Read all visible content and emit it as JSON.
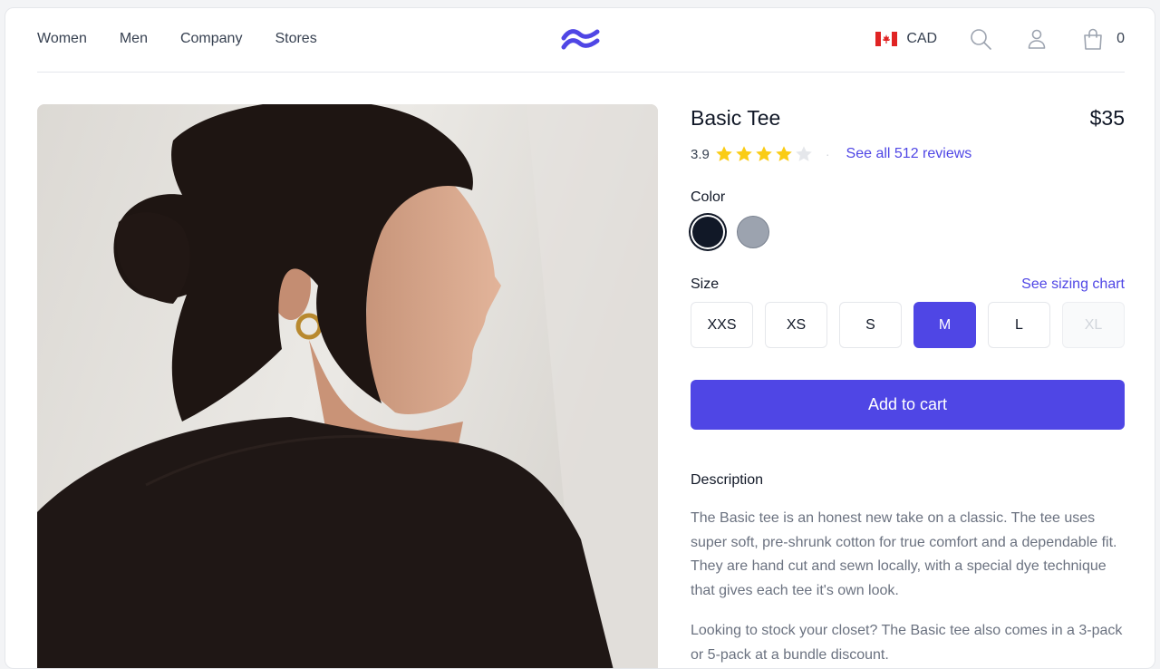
{
  "nav": {
    "items": [
      {
        "label": "Women"
      },
      {
        "label": "Men"
      },
      {
        "label": "Company"
      },
      {
        "label": "Stores"
      }
    ]
  },
  "header": {
    "currency": "CAD",
    "cart_count": "0",
    "icons": {
      "logo": "tailwind-logo-icon",
      "flag": "canada-flag-icon",
      "search": "search-icon",
      "account": "user-icon",
      "cart": "shopping-bag-icon"
    }
  },
  "product": {
    "title": "Basic Tee",
    "price": "$35",
    "rating": {
      "value": "3.9",
      "stars_filled": 4,
      "stars_total": 5,
      "separator": "·",
      "reviews_label": "See all 512 reviews"
    },
    "color": {
      "label": "Color",
      "options": [
        {
          "name": "Black",
          "hex": "#111827",
          "selected": true
        },
        {
          "name": "Heather Grey",
          "hex": "#9ca3af",
          "selected": false
        }
      ]
    },
    "size": {
      "label": "Size",
      "chart_link": "See sizing chart",
      "options": [
        {
          "label": "XXS",
          "state": "available"
        },
        {
          "label": "XS",
          "state": "available"
        },
        {
          "label": "S",
          "state": "available"
        },
        {
          "label": "M",
          "state": "selected"
        },
        {
          "label": "L",
          "state": "available"
        },
        {
          "label": "XL",
          "state": "disabled"
        }
      ]
    },
    "add_to_cart": "Add to cart",
    "description": {
      "title": "Description",
      "paragraphs": [
        "The Basic tee is an honest new take on a classic. The tee uses super soft, pre-shrunk cotton for true comfort and a dependable fit. They are hand cut and sewn locally, with a special dye technique that gives each tee it's own look.",
        "Looking to stock your closet? The Basic tee also comes in a 3-pack or 5-pack at a bundle discount."
      ]
    }
  },
  "colors": {
    "accent": "#4f46e5",
    "star": "#facc15",
    "star_empty": "#e5e7eb"
  }
}
